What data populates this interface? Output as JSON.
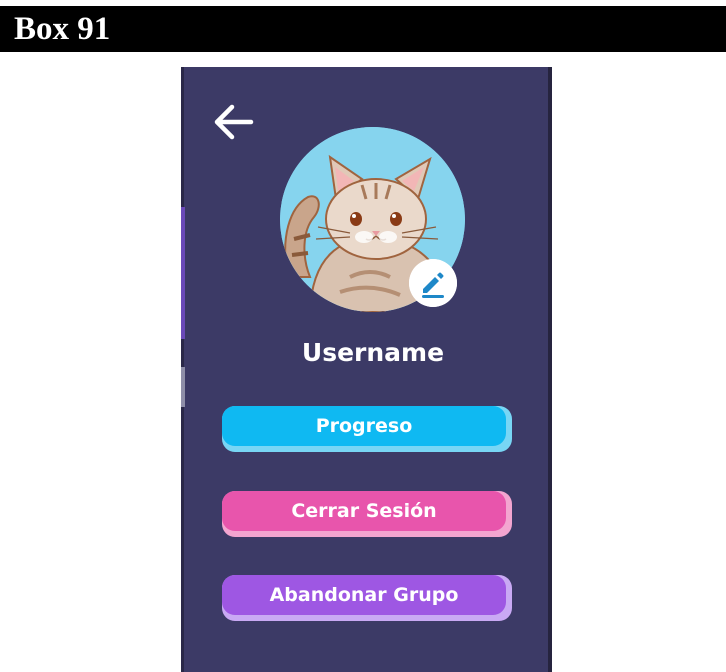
{
  "box": {
    "title": "Box 91"
  },
  "header": {
    "back_icon": "arrow-left-icon"
  },
  "profile": {
    "avatar": "cat-avatar-image",
    "edit_icon": "pencil-icon",
    "username": "Username"
  },
  "actions": {
    "progreso_label": "Progreso",
    "cerrar_sesion_label": "Cerrar Sesión",
    "abandonar_grupo_label": "Abandonar Grupo"
  },
  "colors": {
    "panel_bg": "#3c3a66",
    "progreso": "#0fb9f2",
    "cerrar_sesion": "#e855ac",
    "abandonar_grupo": "#9e57e3",
    "avatar_bg": "#86d4ee"
  }
}
